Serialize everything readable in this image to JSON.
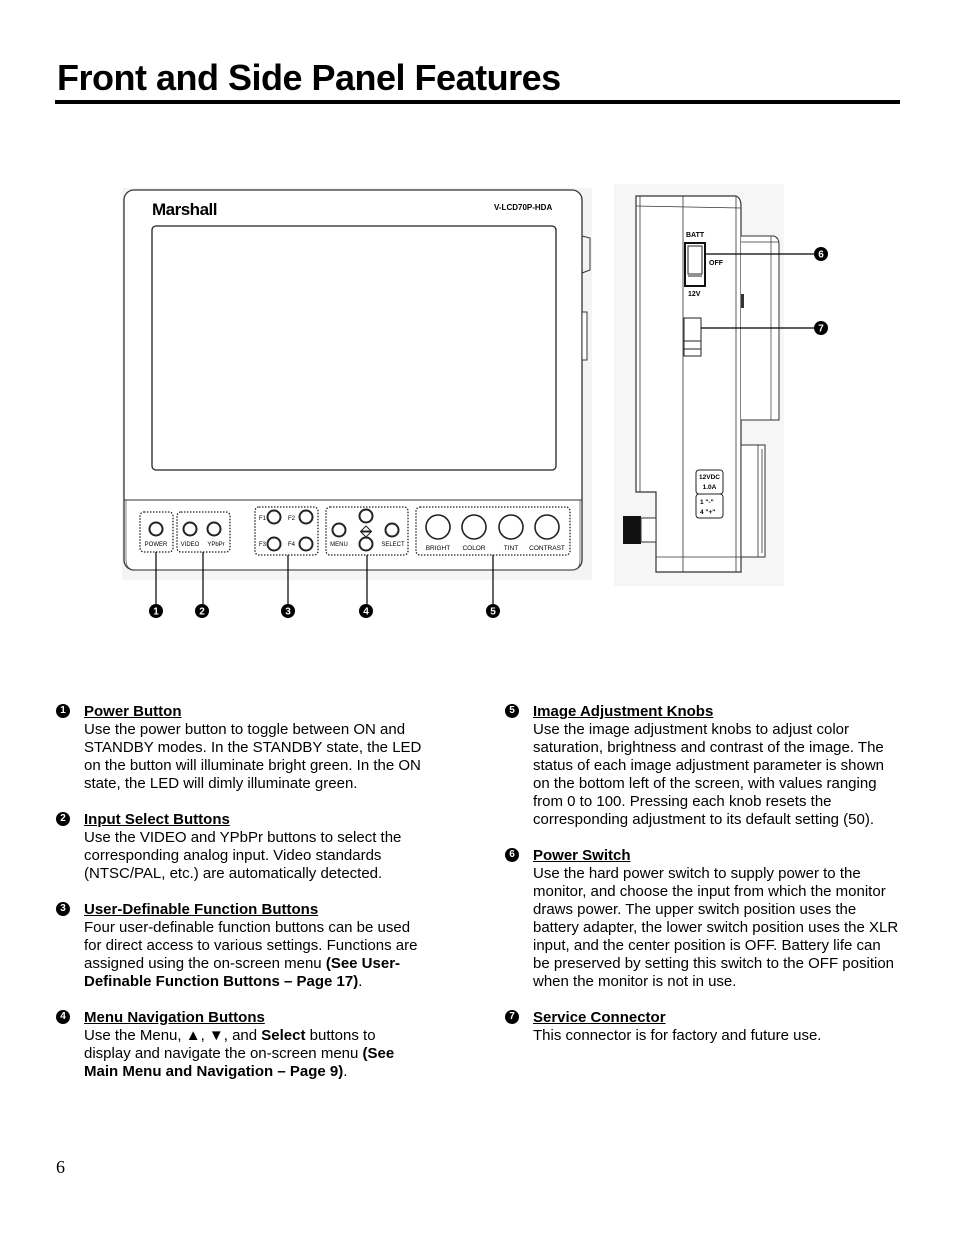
{
  "page": {
    "title": "Front and Side Panel Features",
    "page_number": "6"
  },
  "figure": {
    "front_panel": {
      "brand": "Marshall",
      "model": "V-LCD70P-HDA",
      "buttons": {
        "power": "POWER",
        "video": "VIDEO",
        "ypbpr": "YPbPr",
        "f1": "F1",
        "f2": "F2",
        "f3": "F3",
        "f4": "F4",
        "menu": "MENU",
        "select": "SELECT"
      },
      "knobs": [
        "BRIGHT",
        "COLOR",
        "TINT",
        "CONTRAST"
      ]
    },
    "side_panel": {
      "switch_top_label": "BATT",
      "switch_mid_label": "OFF",
      "switch_bottom_label": "12V",
      "power_label_line1": "12VDC",
      "power_label_line2": "1.0A",
      "pin_label_line1": "1 \"-\"",
      "pin_label_line2": "4 \"+\""
    },
    "callouts": [
      "1",
      "2",
      "3",
      "4",
      "5",
      "6",
      "7"
    ]
  },
  "features": [
    {
      "num": "1",
      "title": "Power Button",
      "body": "Use the power button to toggle between ON and STANDBY modes. In the STANDBY state, the LED on the button will illuminate bright green. In the ON state, the LED will dimly illuminate green."
    },
    {
      "num": "2",
      "title": "Input Select Buttons",
      "body": "Use the VIDEO and YPbPr buttons to select the corresponding analog input. Video standards (NTSC/PAL, etc.) are automatically detected."
    },
    {
      "num": "3",
      "title": "User-Definable Function Buttons",
      "body": "Four user-definable function buttons can be used for direct access to various settings. Functions are assigned using the on-screen menu ",
      "body_bold": "(See User-Definable Function Buttons – Page 17)",
      "body_end": "."
    },
    {
      "num": "4",
      "title": "Menu Navigation Buttons",
      "body": "Use the Menu, ▲, ▼, and ",
      "body_bold": "Select",
      "body_mid": " buttons to display and navigate the on-screen menu ",
      "body_bold2": "(See Main Menu and Navigation – Page 9)",
      "body_end": "."
    },
    {
      "num": "5",
      "title": "Image Adjustment Knobs",
      "body": "Use the image adjustment knobs to adjust color saturation, brightness and contrast of the image. The status of each image adjustment parameter is shown on the bottom left of the screen, with values ranging from 0 to 100. Pressing each knob resets the corresponding adjustment to its default setting (50)."
    },
    {
      "num": "6",
      "title": "Power Switch",
      "body": "Use the hard power switch to supply power to the monitor, and choose the input from which the monitor draws power. The upper switch position uses the battery adapter, the lower switch position uses the XLR input, and the center position is OFF. Battery life can be preserved by setting this switch to the OFF position when the monitor is not in use."
    },
    {
      "num": "7",
      "title": "Service Connector",
      "body": "This connector is for factory and future use."
    }
  ]
}
